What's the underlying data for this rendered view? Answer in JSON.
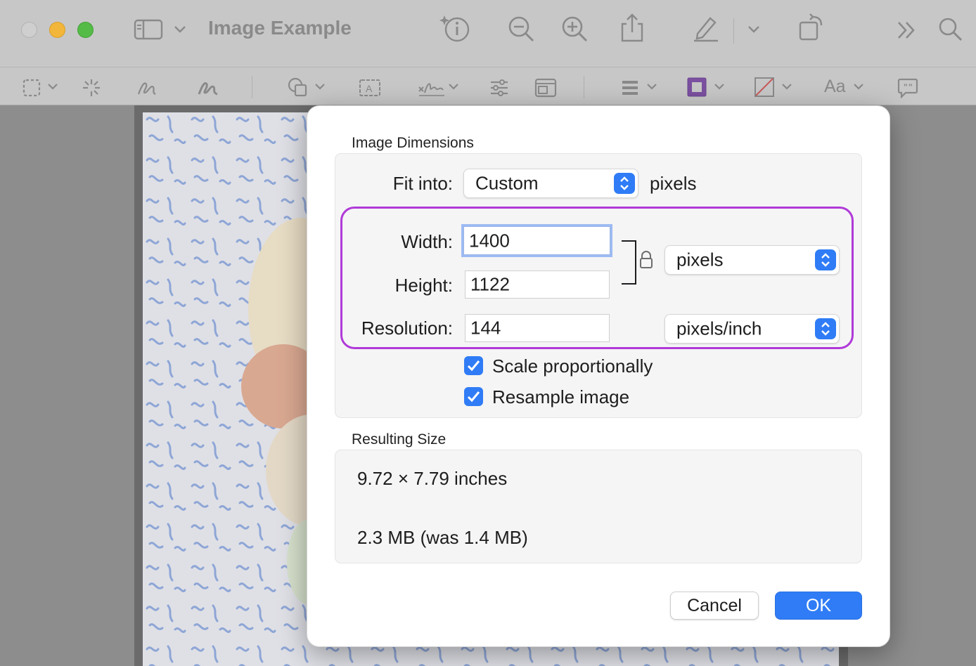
{
  "window": {
    "title": "Image Example"
  },
  "colors": {
    "accent": "#2f7cf6",
    "highlight": "#b03ad8"
  },
  "toolbar": {
    "top_icons": [
      "sidebar-icon",
      "chevron-down-icon",
      "info-icon",
      "zoom-out-icon",
      "zoom-in-icon",
      "share-icon",
      "markup-pen-icon",
      "chevron-down-icon",
      "rotate-icon",
      "more-icon",
      "search-icon"
    ],
    "markup_icons": [
      "selection-icon",
      "instant-alpha-icon",
      "sketch-icon",
      "draw-icon",
      "shapes-icon",
      "text-box-icon",
      "signature-icon",
      "adjust-color-icon",
      "adjust-size-icon",
      "shape-style-icon",
      "border-color-icon",
      "fill-color-icon",
      "text-style-icon",
      "note-icon"
    ],
    "text_style_label": "Aa"
  },
  "dialog": {
    "image_dimensions_title": "Image Dimensions",
    "fit_into": {
      "label": "Fit into:",
      "value": "Custom",
      "unit": "pixels"
    },
    "width": {
      "label": "Width:",
      "value": "1400"
    },
    "height": {
      "label": "Height:",
      "value": "1122"
    },
    "resolution": {
      "label": "Resolution:",
      "value": "144"
    },
    "size_unit": "pixels",
    "resolution_unit": "pixels/inch",
    "scale_proportionally": {
      "label": "Scale proportionally",
      "checked": true
    },
    "resample_image": {
      "label": "Resample image",
      "checked": true
    },
    "resulting_size_title": "Resulting Size",
    "resulting_dimensions": "9.72 × 7.79 inches",
    "resulting_file_size": "2.3 MB (was 1.4 MB)",
    "cancel_label": "Cancel",
    "ok_label": "OK"
  }
}
